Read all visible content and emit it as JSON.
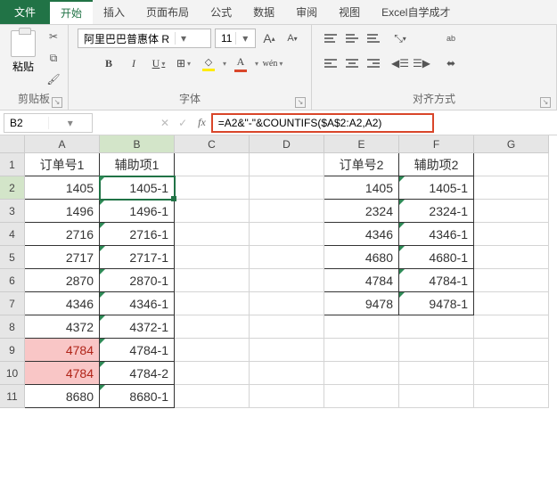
{
  "tabs": {
    "file": "文件",
    "home": "开始",
    "insert": "插入",
    "layout": "页面布局",
    "formula": "公式",
    "data": "数据",
    "review": "审阅",
    "view": "视图",
    "custom": "Excel自学成才"
  },
  "ribbon": {
    "clipboard": {
      "paste": "粘贴",
      "label": "剪贴板"
    },
    "font": {
      "name": "阿里巴巴普惠体 R",
      "size": "11",
      "grow": "A",
      "shrink": "A",
      "bold": "B",
      "italic": "I",
      "underline": "U",
      "wen": "wén",
      "label": "字体"
    },
    "align": {
      "ab": "ab",
      "label": "对齐方式"
    }
  },
  "fx": {
    "namebox": "B2",
    "fx": "fx",
    "formula": "=A2&\"-\"&COUNTIFS($A$2:A2,A2)"
  },
  "columns": [
    "A",
    "B",
    "C",
    "D",
    "E",
    "F",
    "G"
  ],
  "rows": [
    "1",
    "2",
    "3",
    "4",
    "5",
    "6",
    "7",
    "8",
    "9",
    "10",
    "11"
  ],
  "cells": {
    "A1": "订单号1",
    "B1": "辅助项1",
    "E1": "订单号2",
    "F1": "辅助项2",
    "A2": "1405",
    "B2": "1405-1",
    "E2": "1405",
    "F2": "1405-1",
    "A3": "1496",
    "B3": "1496-1",
    "E3": "2324",
    "F3": "2324-1",
    "A4": "2716",
    "B4": "2716-1",
    "E4": "4346",
    "F4": "4346-1",
    "A5": "2717",
    "B5": "2717-1",
    "E5": "4680",
    "F5": "4680-1",
    "A6": "2870",
    "B6": "2870-1",
    "E6": "4784",
    "F6": "4784-1",
    "A7": "4346",
    "B7": "4346-1",
    "E7": "9478",
    "F7": "9478-1",
    "A8": "4372",
    "B8": "4372-1",
    "A9": "4784",
    "B9": "4784-1",
    "A10": "4784",
    "B10": "4784-2",
    "A11": "8680",
    "B11": "8680-1"
  },
  "chart_data": {
    "type": "table",
    "title": "",
    "columns": [
      "订单号1",
      "辅助项1",
      "订单号2",
      "辅助项2"
    ],
    "rows": [
      [
        1405,
        "1405-1",
        1405,
        "1405-1"
      ],
      [
        1496,
        "1496-1",
        2324,
        "2324-1"
      ],
      [
        2716,
        "2716-1",
        4346,
        "4346-1"
      ],
      [
        2717,
        "2717-1",
        4680,
        "4680-1"
      ],
      [
        2870,
        "2870-1",
        4784,
        "4784-1"
      ],
      [
        4346,
        "4346-1",
        9478,
        "9478-1"
      ],
      [
        4372,
        "4372-1",
        null,
        null
      ],
      [
        4784,
        "4784-1",
        null,
        null
      ],
      [
        4784,
        "4784-2",
        null,
        null
      ],
      [
        8680,
        "8680-1",
        null,
        null
      ]
    ]
  }
}
